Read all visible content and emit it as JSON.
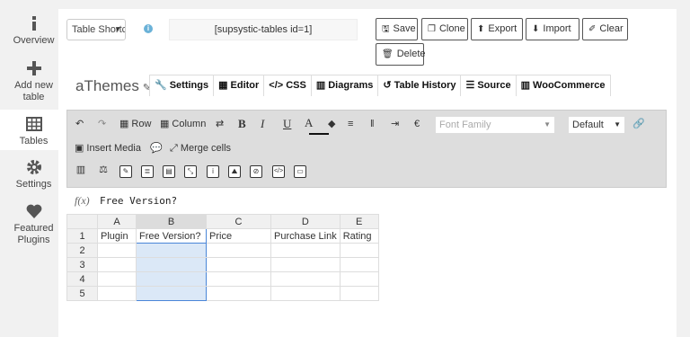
{
  "sidebar": {
    "items": [
      {
        "label": "Overview",
        "icon": "info-icon"
      },
      {
        "label": "Add new table",
        "icon": "plus-icon"
      },
      {
        "label": "Tables",
        "icon": "table-icon"
      },
      {
        "label": "Settings",
        "icon": "gear-icon"
      },
      {
        "label": "Featured Plugins",
        "icon": "heart-icon"
      }
    ]
  },
  "header": {
    "shortcode_select": "Table Shortcode",
    "shortcode_value": "[supsystic-tables id=1]",
    "buttons": {
      "save": "Save",
      "clone": "Clone",
      "export": "Export",
      "import": "Import",
      "clear": "Clear",
      "delete": "Delete"
    }
  },
  "table_title": "aThemes",
  "tabs": [
    "Settings",
    "Editor",
    "CSS",
    "Diagrams",
    "Table History",
    "Source",
    "WooCommerce"
  ],
  "toolbar": {
    "row": "Row",
    "column": "Column",
    "font_family_placeholder": "Font Family",
    "font_size": "Default",
    "insert_media": "Insert Media",
    "merge_cells": "Merge cells",
    "currency_symbol": "€"
  },
  "formula": {
    "label": "f(x)",
    "value": "Free Version?"
  },
  "grid": {
    "columns": [
      "A",
      "B",
      "C",
      "D",
      "E"
    ],
    "rows": [
      {
        "n": "1",
        "cells": [
          "Plugin",
          "Free Version?",
          "Price",
          "Purchase Link",
          "Rating"
        ]
      },
      {
        "n": "2",
        "cells": [
          "",
          "",
          "",
          "",
          ""
        ]
      },
      {
        "n": "3",
        "cells": [
          "",
          "",
          "",
          "",
          ""
        ]
      },
      {
        "n": "4",
        "cells": [
          "",
          "",
          "",
          "",
          ""
        ]
      },
      {
        "n": "5",
        "cells": [
          "",
          "",
          "",
          "",
          ""
        ]
      }
    ]
  },
  "colors": {
    "accent": "#4a86d8",
    "selection": "#dbe8f7",
    "info": "#6bb2d8"
  }
}
